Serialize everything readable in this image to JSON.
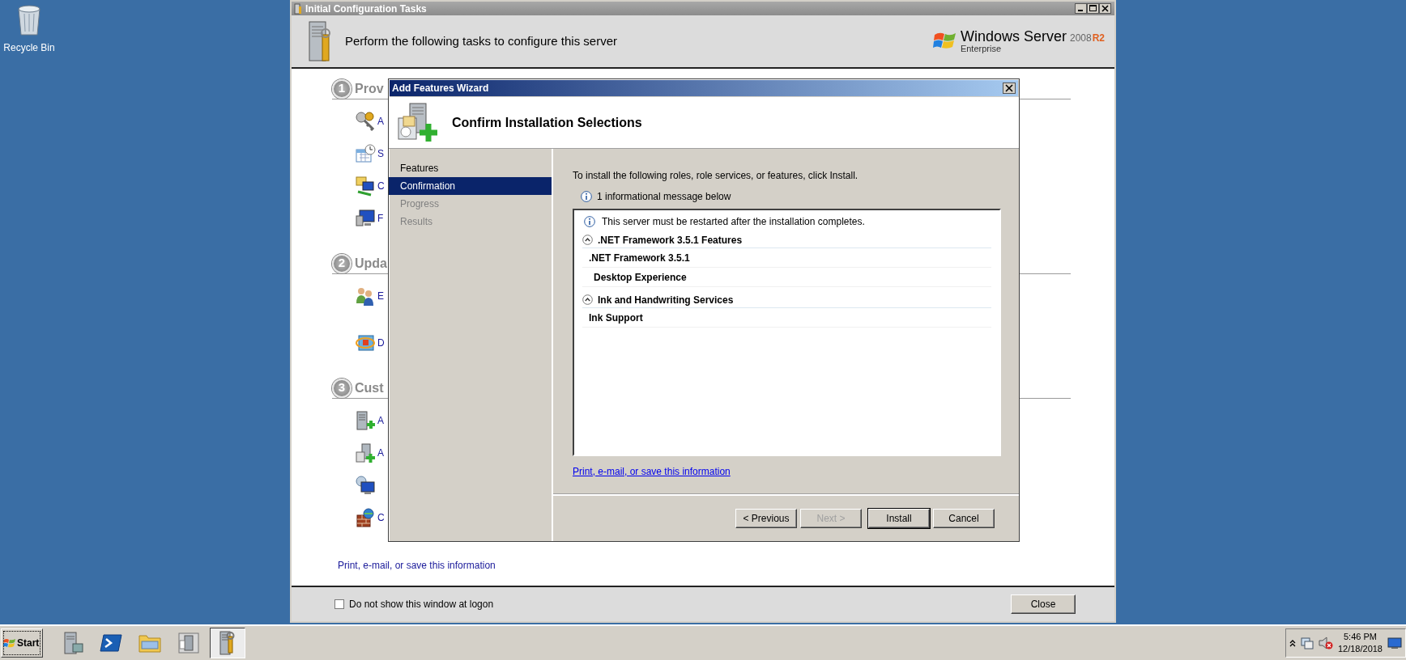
{
  "desktop": {
    "icons": [
      {
        "label": "Recycle Bin",
        "kind": "recycle-bin"
      }
    ]
  },
  "back_window": {
    "title": "Initial Configuration Tasks",
    "header": "Perform the following tasks to configure this server",
    "logo": {
      "brand": "Windows Server",
      "version": "2008",
      "release": "R2",
      "edition": "Enterprise"
    },
    "sections": [
      {
        "number": "1",
        "title": "Prov",
        "tasks": [
          {
            "label": "A",
            "kind": "keys"
          },
          {
            "label": "S",
            "kind": "calendar"
          },
          {
            "label": "C",
            "kind": "network"
          },
          {
            "label": "F",
            "kind": "monitor"
          }
        ]
      },
      {
        "number": "2",
        "title": "Upda",
        "tasks": [
          {
            "label": "E",
            "kind": "users"
          },
          {
            "label": "D",
            "kind": "update"
          }
        ]
      },
      {
        "number": "3",
        "title": "Cust",
        "tasks": [
          {
            "label": "A",
            "kind": "server-add"
          },
          {
            "label": "A",
            "kind": "features-add"
          },
          {
            "kind": "remote"
          },
          {
            "label": "C",
            "kind": "firewall"
          }
        ]
      }
    ],
    "link": "Print, e-mail, or save this information",
    "dont_show": {
      "label": "Do not show this window at logon",
      "checked": false
    },
    "close_button": "Close"
  },
  "dialog": {
    "title": "Add Features Wizard",
    "heading": "Confirm Installation Selections",
    "steps": [
      {
        "label": "Features",
        "selected": false,
        "disabled": false
      },
      {
        "label": "Confirmation",
        "selected": true,
        "disabled": false
      },
      {
        "label": "Progress",
        "selected": false,
        "disabled": true
      },
      {
        "label": "Results",
        "selected": false,
        "disabled": true
      }
    ],
    "intro": "To install the following roles, role services, or features, click Install.",
    "info": "1 informational message below",
    "results": {
      "message": "This server must be restarted after the installation completes.",
      "groups": [
        {
          "title": ".NET Framework 3.5.1 Features",
          "expanded": true,
          "children": [
            {
              "label": ".NET Framework 3.5.1"
            },
            {
              "label": "Desktop Experience"
            }
          ]
        },
        {
          "title": "Ink and Handwriting Services",
          "expanded": true,
          "children": [
            {
              "label": "Ink Support"
            }
          ]
        }
      ]
    },
    "link": "Print, e-mail, or save this information",
    "buttons": [
      {
        "label": "< Previous",
        "disabled": false,
        "default": false
      },
      {
        "label": "Next >",
        "disabled": true,
        "default": false
      },
      {
        "label": "Install",
        "disabled": false,
        "default": true
      },
      {
        "label": "Cancel",
        "disabled": false,
        "default": false
      }
    ]
  },
  "taskbar": {
    "start": "Start",
    "apps": [
      {
        "kind": "server",
        "selected": false
      },
      {
        "kind": "terminal",
        "selected": false
      },
      {
        "kind": "folder",
        "selected": false
      },
      {
        "kind": "server-manager",
        "selected": false
      },
      {
        "kind": "config",
        "selected": true
      }
    ],
    "clock": {
      "time": "5:46 PM",
      "date": "12/18/2018"
    }
  }
}
